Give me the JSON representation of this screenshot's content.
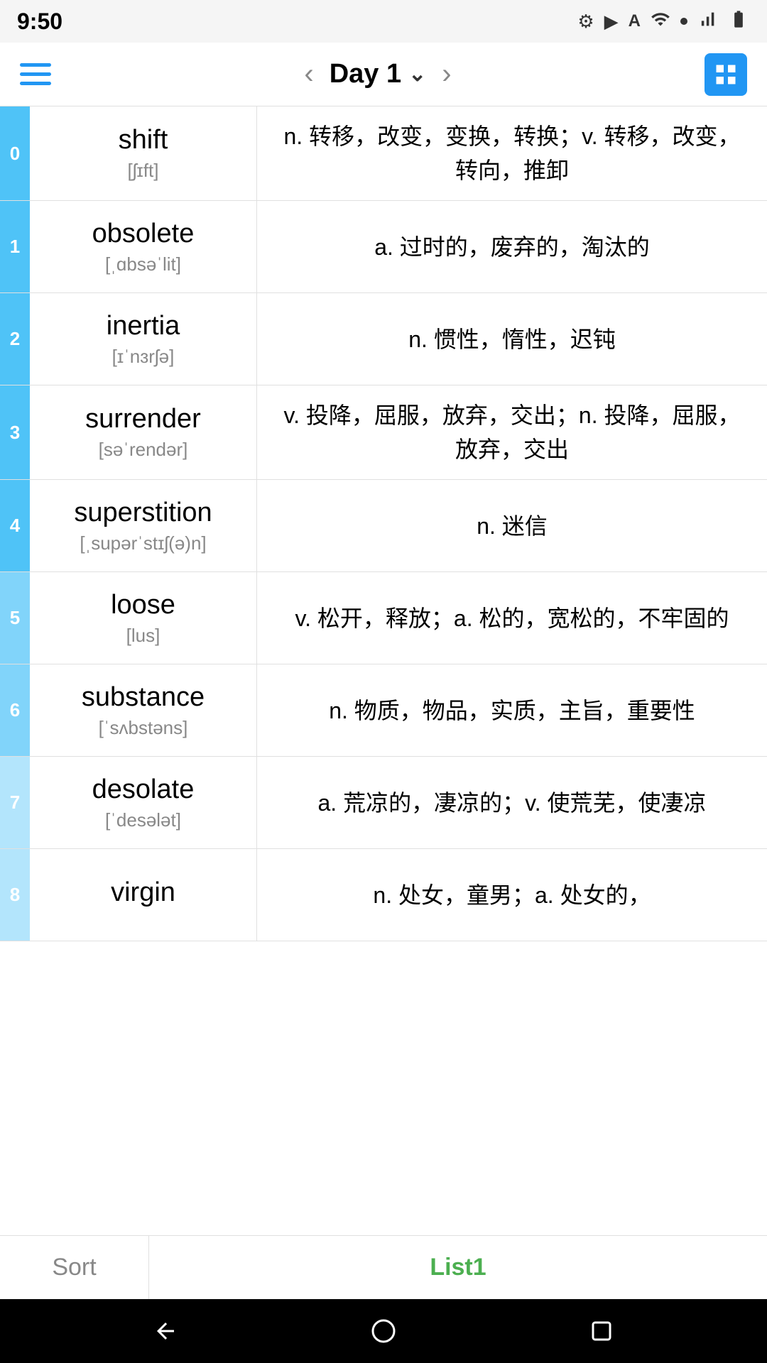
{
  "statusBar": {
    "time": "9:50"
  },
  "topNav": {
    "title": "Day 1",
    "prevLabel": "‹",
    "nextLabel": "›"
  },
  "words": [
    {
      "index": "0",
      "word": "shift",
      "phonetic": "[ʃɪft]",
      "definition": "n. 转移，改变，变换，转换；v. 转移，改变，转向，推卸",
      "indexStyle": "normal"
    },
    {
      "index": "1",
      "word": "obsolete",
      "phonetic": "[ˌɑbsəˈlit]",
      "definition": "a. 过时的，废弃的，淘汰的",
      "indexStyle": "normal"
    },
    {
      "index": "2",
      "word": "inertia",
      "phonetic": "[ɪˈnɜrʃə]",
      "definition": "n. 惯性，惰性，迟钝",
      "indexStyle": "normal"
    },
    {
      "index": "3",
      "word": "surrender",
      "phonetic": "[səˈrendər]",
      "definition": "v. 投降，屈服，放弃，交出；n. 投降，屈服，放弃，交出",
      "indexStyle": "normal"
    },
    {
      "index": "4",
      "word": "superstition",
      "phonetic": "[ˌsupərˈstɪʃ(ə)n]",
      "definition": "n. 迷信",
      "indexStyle": "normal"
    },
    {
      "index": "5",
      "word": "loose",
      "phonetic": "[lus]",
      "definition": "v. 松开，释放；a. 松的，宽松的，不牢固的",
      "indexStyle": "lighter"
    },
    {
      "index": "6",
      "word": "substance",
      "phonetic": "[ˈsʌbstəns]",
      "definition": "n. 物质，物品，实质，主旨，重要性",
      "indexStyle": "lighter"
    },
    {
      "index": "7",
      "word": "desolate",
      "phonetic": "[ˈdesələt]",
      "definition": "a. 荒凉的，凄凉的；v. 使荒芜，使凄凉",
      "indexStyle": "lightest"
    },
    {
      "index": "8",
      "word": "virgin",
      "phonetic": "",
      "definition": "n. 处女，童男；a. 处女的，",
      "indexStyle": "lightest"
    }
  ],
  "bottomTabs": {
    "sort": "Sort",
    "list1": "List1"
  }
}
